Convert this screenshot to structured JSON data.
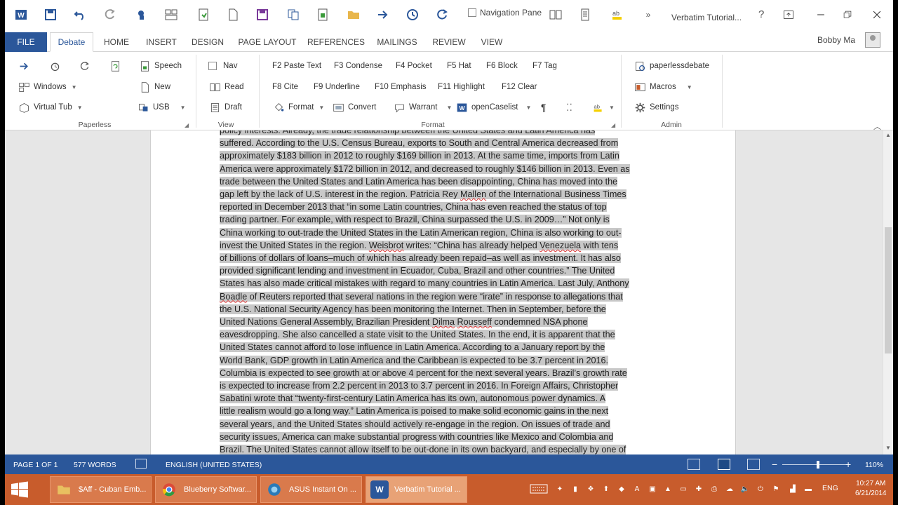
{
  "titlebar": {
    "nav_pane_label": "Navigation Pane",
    "doc_title": "Verbatim Tutorial...",
    "help": "?"
  },
  "tabs": {
    "file": "FILE",
    "items": [
      "Debate",
      "HOME",
      "INSERT",
      "DESIGN",
      "PAGE LAYOUT",
      "REFERENCES",
      "MAILINGS",
      "REVIEW",
      "VIEW"
    ],
    "active": "Debate"
  },
  "user": {
    "name": "Bobby Ma"
  },
  "ribbon": {
    "paperless": {
      "label": "Paperless",
      "windows": "Windows",
      "virtual_tub": "Virtual Tub",
      "speech": "Speech",
      "new": "New",
      "usb": "USB"
    },
    "view": {
      "label": "View",
      "nav": "Nav",
      "read": "Read",
      "draft": "Draft"
    },
    "format": {
      "label": "Format",
      "keys_row1": [
        "F2 Paste Text",
        "F3 Condense",
        "F4 Pocket",
        "F5 Hat",
        "F6 Block",
        "F7 Tag"
      ],
      "keys_row2": [
        "F8 Cite",
        "F9 Underline",
        "F10 Emphasis",
        "F11 Highlight",
        "F12 Clear"
      ],
      "format_btn": "Format",
      "convert": "Convert",
      "warrant": "Warrant",
      "opencaselist": "openCaselist"
    },
    "admin": {
      "label": "Admin",
      "paperlessdebate": "paperlessdebate",
      "macros": "Macros",
      "settings": "Settings"
    }
  },
  "document": {
    "lines": [
      [
        {
          "t": "policy interests. Already, the trade relationship between the United States and Latin America has"
        }
      ],
      [
        {
          "t": "suffered. According to the U.S. Census Bureau, exports to South and Central America decreased from"
        }
      ],
      [
        {
          "t": "approximately $183 billion in 2012 to roughly $169 billion in 2013. At the same time, imports from Latin"
        }
      ],
      [
        {
          "t": "America were approximately $172 billion in 2012, and decreased to roughly $146 billion in 2013. Even as"
        }
      ],
      [
        {
          "t": "trade between the United States and Latin America has been disappointing, China has moved into the"
        }
      ],
      [
        {
          "t": "gap left by the lack of U.S. interest in the region. Patricia Rey "
        },
        {
          "t": "Mallen",
          "s": true
        },
        {
          "t": " of the International Business Times"
        }
      ],
      [
        {
          "t": "reported in December 2013 that “in some Latin countries, China has even reached the status of top"
        }
      ],
      [
        {
          "t": "trading partner. For example, with respect to Brazil, China surpassed the U.S. in 2009…” Not only is"
        }
      ],
      [
        {
          "t": "China working to out-trade the United States in the Latin American region, China is also working to out-"
        }
      ],
      [
        {
          "t": "invest the United States in the region. "
        },
        {
          "t": "Weisbrot",
          "s": true
        },
        {
          "t": " writes: “China has already helped "
        },
        {
          "t": "Venezuela",
          "s": true
        },
        {
          "t": " with tens"
        }
      ],
      [
        {
          "t": "of billions of dollars of loans–much of which has already been repaid–as well as investment. It has also"
        }
      ],
      [
        {
          "t": "provided significant lending and investment in Ecuador, Cuba, Brazil and other countries.” The United"
        }
      ],
      [
        {
          "t": "States has also made critical mistakes with regard to many countries in Latin America. Last July, Anthony"
        }
      ],
      [
        {
          "t": "Boadle",
          "s": true
        },
        {
          "t": " of Reuters reported that several nations in the region were “irate” in response to allegations that"
        }
      ],
      [
        {
          "t": "the U.S. National Security Agency has been monitoring the Internet. Then in September, before the"
        }
      ],
      [
        {
          "t": "United Nations General Assembly, Brazilian President "
        },
        {
          "t": "Dilma",
          "s": true
        },
        {
          "t": " "
        },
        {
          "t": "Rousseff",
          "s": true
        },
        {
          "t": " condemned NSA phone"
        }
      ],
      [
        {
          "t": "eavesdropping. She also cancelled a state visit to the United States. In the end, it is apparent that the"
        }
      ],
      [
        {
          "t": "United States cannot afford to lose influence in Latin America. According to a January report by the"
        }
      ],
      [
        {
          "t": "World Bank, GDP growth in Latin America and the Caribbean is expected to be 3.7 percent in 2016."
        }
      ],
      [
        {
          "t": "Columbia is expected to see growth at or above 4 percent for the next several years. Brazil’s growth rate"
        }
      ],
      [
        {
          "t": "is expected to increase from 2.2 percent in 2013 to 3.7 percent in 2016. In Foreign Affairs, Christopher"
        }
      ],
      [
        {
          "t": "Sabatini wrote that “twenty-first-century Latin America has its own, autonomous power dynamics. A"
        }
      ],
      [
        {
          "t": "little realism would go a long way.” Latin America is poised to make solid economic gains in the next"
        }
      ],
      [
        {
          "t": "several years, and the United States should actively re-engage in the region. On issues of trade and"
        }
      ],
      [
        {
          "t": "security issues, America can make substantial progress with countries like Mexico and Colombia and"
        }
      ],
      [
        {
          "t": "Brazil. The United States cannot allow itself to be out-done in its own backyard, and especially by one of"
        }
      ]
    ]
  },
  "status": {
    "page": "PAGE 1 OF 1",
    "words": "577 WORDS",
    "language": "ENGLISH (UNITED STATES)",
    "zoom": "110%",
    "zoom_level": 0.55
  },
  "taskbar": {
    "items": [
      {
        "label": "$Aff - Cuban Emb...",
        "icon": "folder-icon",
        "color": "#e0b040"
      },
      {
        "label": "Blueberry Softwar...",
        "icon": "chrome-icon",
        "color": "#3a9a3a"
      },
      {
        "label": "ASUS Instant On ...",
        "icon": "asus-icon",
        "color": "#2a7ab8"
      },
      {
        "label": "Verbatim Tutorial ...",
        "icon": "word-icon",
        "color": "#2b579a",
        "glyph": "W"
      }
    ],
    "lang": "ENG",
    "time": "10:27 AM",
    "date": "6/21/2014"
  },
  "colors": {
    "accent": "#2b579a",
    "taskbar": "#c85c2c",
    "highlight": "#c8c8c8"
  }
}
